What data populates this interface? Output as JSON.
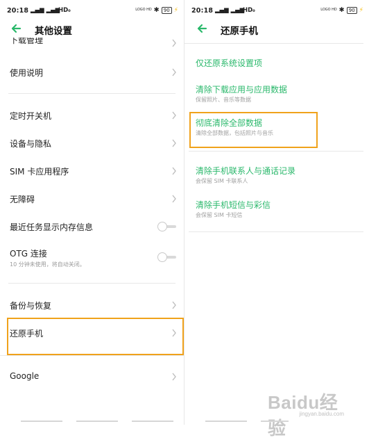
{
  "left": {
    "status": {
      "time": "20:18",
      "signal": "▂▄▆ ▂▄▆",
      "wifi": "HD₀",
      "hd_logo": "LOGO HD",
      "bluetooth": "✱",
      "battery": "90"
    },
    "title": "其他设置",
    "items": [
      {
        "label": "下载管理"
      },
      {
        "label": "使用说明"
      },
      {
        "label": "定时开关机"
      },
      {
        "label": "设备与隐私"
      },
      {
        "label": "SIM 卡应用程序"
      },
      {
        "label": "无障碍"
      },
      {
        "label": "最近任务显示内存信息"
      },
      {
        "label": "OTG 连接",
        "sub": "10 分钟未使用，将自动关闭。"
      },
      {
        "label": "备份与恢复"
      },
      {
        "label": "还原手机"
      },
      {
        "label": "Google"
      }
    ]
  },
  "right": {
    "status": {
      "time": "20:18",
      "signal": "▂▄▆ ▂▄▆",
      "wifi": "HD₀",
      "hd_logo": "LOGO HD",
      "bluetooth": "✱",
      "battery": "90"
    },
    "title": "还原手机",
    "options": [
      {
        "label": "仅还原系统设置项"
      },
      {
        "label": "清除下载应用与应用数据",
        "sub": "保留照片、音乐等数据"
      },
      {
        "label": "彻底清除全部数据",
        "sub": "清除全部数据，包括照片与音乐"
      },
      {
        "label": "清除手机联系人与通话记录",
        "sub": "会保留 SIM 卡联系人"
      },
      {
        "label": "清除手机短信与彩信",
        "sub": "会保留 SIM 卡短信"
      }
    ]
  },
  "watermark": {
    "logo": "Baidu经验",
    "url": "jingyan.baidu.com"
  },
  "colors": {
    "accent_green": "#2ab86b",
    "highlight_orange": "#f0a21b",
    "back_arrow_green": "#2ab86b"
  },
  "icons": [
    "back-arrow-icon",
    "chevron-right-icon",
    "toggle-switch",
    "bluetooth-icon",
    "battery-icon",
    "wifi-icon",
    "signal-icon"
  ]
}
